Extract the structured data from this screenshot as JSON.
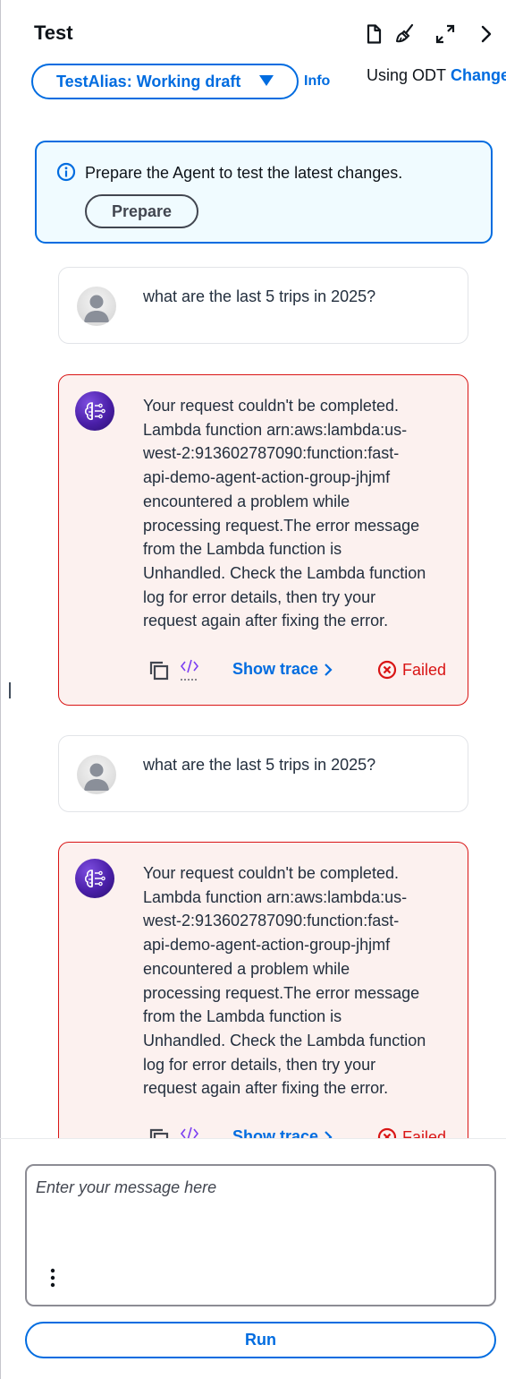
{
  "header": {
    "title": "Test",
    "icons": [
      "document-icon",
      "clear-brush-icon",
      "expand-icon",
      "chevron-right-icon"
    ]
  },
  "alias": {
    "selected": "TestAlias: Working draft",
    "info_label": "Info",
    "model_text": "Using ODT",
    "change_label": "Change"
  },
  "alert": {
    "message": "Prepare the Agent to test the latest changes.",
    "button_label": "Prepare"
  },
  "messages": [
    {
      "role": "user",
      "text": "what are the last 5 trips in 2025?"
    },
    {
      "role": "agent",
      "lines": [
        "Your request couldn't be completed.",
        "Lambda function arn:aws:lambda:us-",
        "west-2:913602787090:function:fast-",
        "api-demo-agent-action-group-jhjmf",
        "encountered a problem while",
        "processing request.The error message",
        "from the Lambda function is",
        "Unhandled. Check the Lambda function",
        "log for error details, then try your",
        "request again after fixing the error."
      ],
      "trace_label": "Show trace",
      "status": "Failed"
    },
    {
      "role": "user",
      "text": "what are the last 5 trips in 2025?"
    },
    {
      "role": "agent",
      "lines": [
        "Your request couldn't be completed.",
        "Lambda function arn:aws:lambda:us-",
        "west-2:913602787090:function:fast-",
        "api-demo-agent-action-group-jhjmf",
        "encountered a problem while",
        "processing request.The error message",
        "from the Lambda function is",
        "Unhandled. Check the Lambda function",
        "log for error details, then try your",
        "request again after fixing the error."
      ],
      "trace_label": "Show trace",
      "status": "Failed"
    }
  ],
  "input": {
    "value": "",
    "placeholder": "Enter your message here"
  },
  "run_label": "Run",
  "colors": {
    "accent": "#006ce0",
    "error": "#d91515",
    "error_bg": "#fcf1ef",
    "info_bg": "#f0fbff"
  }
}
